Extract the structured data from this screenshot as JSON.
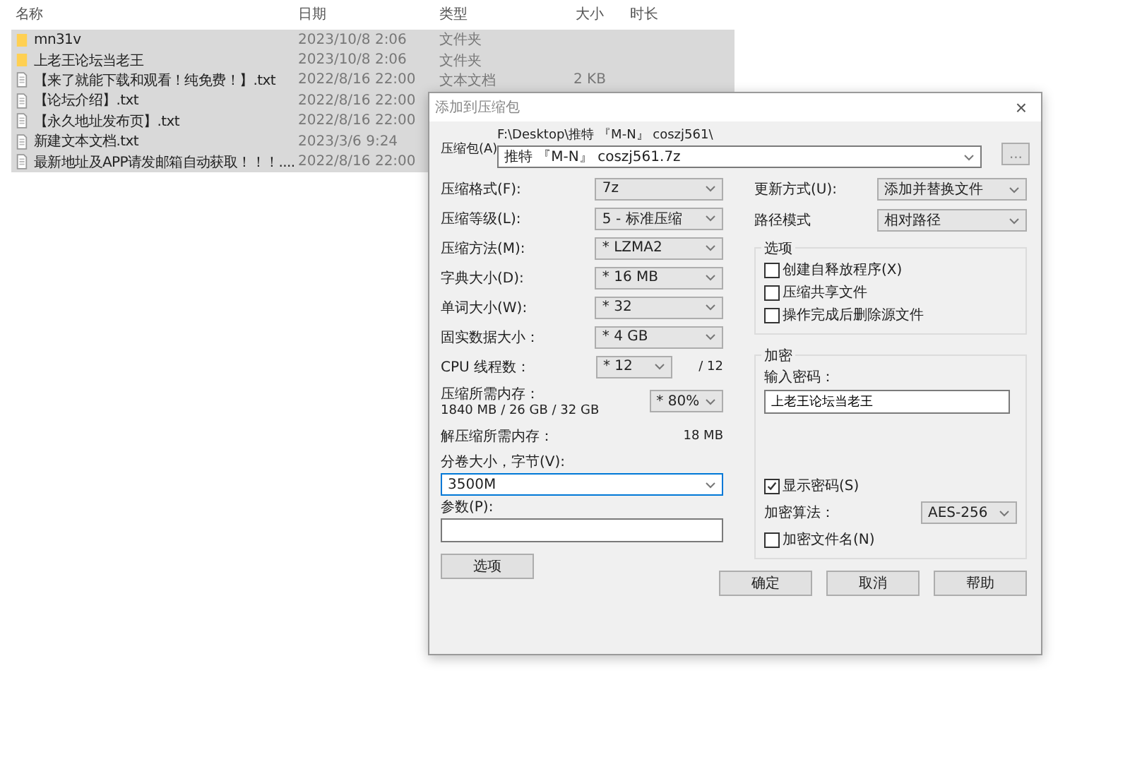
{
  "file_list": {
    "columns": [
      "名称",
      "日期",
      "类型",
      "大小",
      "时长"
    ],
    "rows": [
      {
        "kind": "folder",
        "name": "mn31v",
        "date": "2023/10/8 2:06",
        "type": "文件夹",
        "selected": true
      },
      {
        "kind": "folder",
        "name": "上老王论坛当老王",
        "date": "2023/10/8 2:06",
        "type": "文件夹",
        "selected": true
      },
      {
        "kind": "text",
        "name": "【来了就能下载和观看！纯免费！】.txt",
        "date": "2022/8/16 22:00",
        "type": "文本文档",
        "size": "2 KB",
        "selected": true
      },
      {
        "kind": "text",
        "name": "【论坛介绍】.txt",
        "date": "2022/8/16 22:00",
        "selected": true
      },
      {
        "kind": "text",
        "name": "【永久地址发布页】.txt",
        "date": "2022/8/16 22:00",
        "selected": true
      },
      {
        "kind": "text",
        "name": "新建文本文档.txt",
        "date": "2023/3/6 9:24",
        "selected": true
      },
      {
        "kind": "text",
        "name": "最新地址及APP请发邮箱自动获取！！！....",
        "date": "2022/8/16 22:00",
        "selected": true
      }
    ]
  },
  "dialog": {
    "title": "添加到压缩包",
    "close": "×",
    "archive": {
      "label": "压缩包(A)",
      "path": "F:\\Desktop\\推特 『M-N』 coszj561\\",
      "value": "推特 『M-N』 coszj561.7z",
      "browse": "..."
    },
    "left": [
      {
        "kind": "select",
        "label": "压缩格式(F):",
        "value": "7z"
      },
      {
        "kind": "select",
        "label": "压缩等级(L):",
        "value": "5 - 标准压缩"
      },
      {
        "kind": "select",
        "label": "压缩方法(M):",
        "value": "* LZMA2"
      },
      {
        "kind": "select",
        "label": "字典大小(D):",
        "value": "* 16 MB"
      },
      {
        "kind": "select",
        "label": "单词大小(W):",
        "value": "* 32"
      },
      {
        "kind": "select",
        "label": "固实数据大小：",
        "value": "* 4 GB"
      },
      {
        "kind": "cpu",
        "label": "CPU 线程数：",
        "value": "* 12",
        "suffix": "/ 12"
      },
      {
        "kind": "memory",
        "label": "压缩所需内存：",
        "detail": "1840 MB / 26 GB / 32 GB",
        "value": "* 80%"
      },
      {
        "kind": "info",
        "label": "解压缩所需内存：",
        "value": "18 MB"
      }
    ],
    "volume": {
      "label": "分卷大小，字节(V):",
      "value": "3500M"
    },
    "params": {
      "label": "参数(P):"
    },
    "options_button": "选项",
    "right": [
      {
        "label": "更新方式(U):",
        "value": "添加并替换文件"
      },
      {
        "label": "路径模式",
        "value": "相对路径"
      }
    ],
    "options": {
      "title": "选项",
      "items": [
        {
          "label": "创建自释放程序(X)",
          "checked": false
        },
        {
          "label": "压缩共享文件",
          "checked": false
        },
        {
          "label": "操作完成后删除源文件",
          "checked": false
        }
      ]
    },
    "encryption": {
      "title": "加密",
      "password_label": "输入密码：",
      "password": "上老王论坛当老王",
      "show_password": {
        "label": "显示密码(S)",
        "checked": true
      },
      "method": {
        "label": "加密算法：",
        "value": "AES-256"
      },
      "encrypt_names": {
        "label": "加密文件名(N)",
        "checked": false
      }
    },
    "buttons": [
      "确定",
      "取消",
      "帮助"
    ]
  }
}
